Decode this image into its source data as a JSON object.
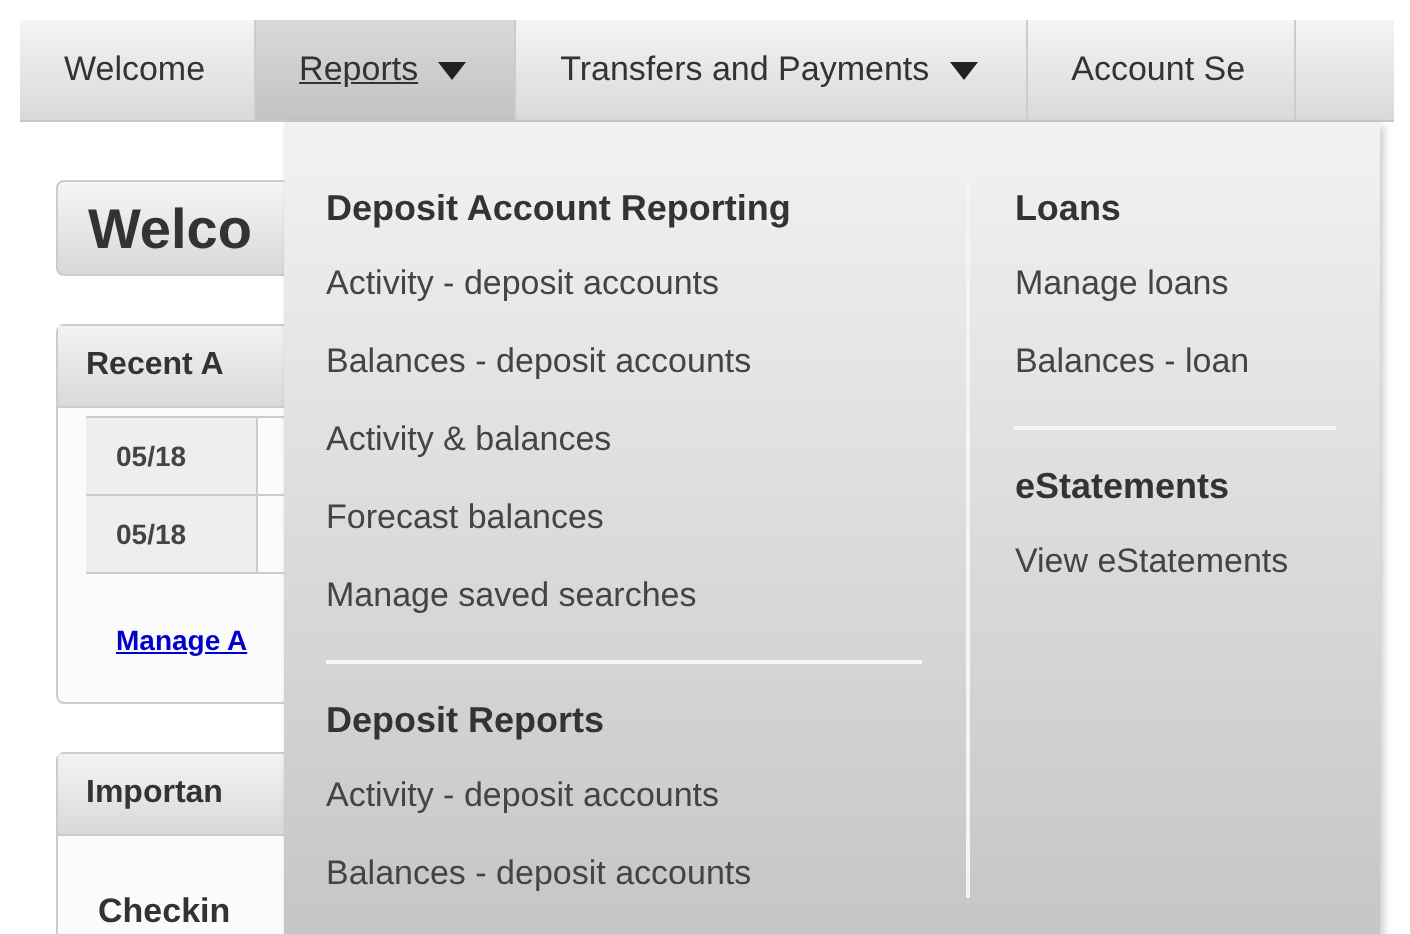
{
  "nav_tabs": [
    {
      "label": "Welcome",
      "caret": false,
      "selected": false
    },
    {
      "label": "Reports",
      "caret": true,
      "selected": true
    },
    {
      "label": "Transfers and Payments",
      "caret": true,
      "selected": false
    },
    {
      "label": "Account Se",
      "caret": false,
      "selected": false
    }
  ],
  "page_title": "Welco",
  "recent_panel": {
    "title": "Recent A",
    "rows": [
      {
        "date": "05/18"
      },
      {
        "date": "05/18"
      }
    ],
    "link": "Manage A"
  },
  "important_panel": {
    "title": "Importan",
    "subheading": "Checkin"
  },
  "dropdown": {
    "columns": [
      {
        "sections": [
          {
            "heading": "Deposit Account Reporting",
            "items": [
              "Activity - deposit accounts",
              "Balances - deposit accounts",
              "Activity & balances",
              "Forecast balances",
              "Manage saved searches"
            ]
          },
          {
            "heading": "Deposit Reports",
            "items": [
              "Activity - deposit accounts",
              "Balances - deposit accounts"
            ]
          }
        ]
      },
      {
        "sections": [
          {
            "heading": "Loans",
            "items": [
              "Manage loans",
              "Balances - loan"
            ]
          },
          {
            "heading": "eStatements",
            "items": [
              "View eStatements"
            ]
          }
        ]
      }
    ]
  }
}
